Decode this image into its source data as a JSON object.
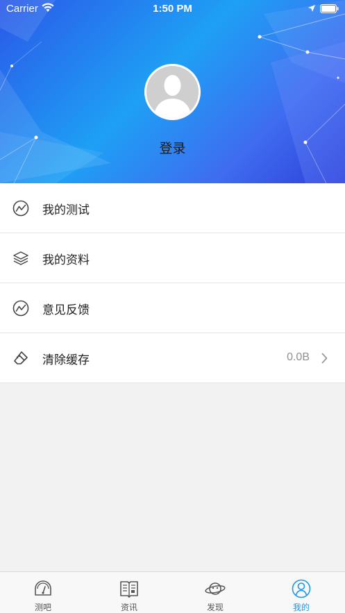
{
  "status_bar": {
    "carrier": "Carrier",
    "time": "1:50 PM"
  },
  "profile": {
    "login_label": "登录"
  },
  "menu": {
    "items": [
      {
        "label": "我的测试",
        "icon": "chart-line-icon"
      },
      {
        "label": "我的资料",
        "icon": "layers-icon"
      },
      {
        "label": "意见反馈",
        "icon": "chart-line-icon"
      },
      {
        "label": "清除缓存",
        "icon": "eraser-icon",
        "value": "0.0B"
      }
    ]
  },
  "tabbar": {
    "tabs": [
      {
        "label": "测吧",
        "icon": "gauge-icon",
        "active": false
      },
      {
        "label": "资讯",
        "icon": "book-icon",
        "active": false
      },
      {
        "label": "发现",
        "icon": "planet-icon",
        "active": false
      },
      {
        "label": "我的",
        "icon": "user-icon",
        "active": true
      }
    ]
  },
  "colors": {
    "accent": "#1e96e8",
    "header_gradient_start": "#2a58e8",
    "header_gradient_mid": "#1ea0f5",
    "background": "#f2f2f2"
  }
}
